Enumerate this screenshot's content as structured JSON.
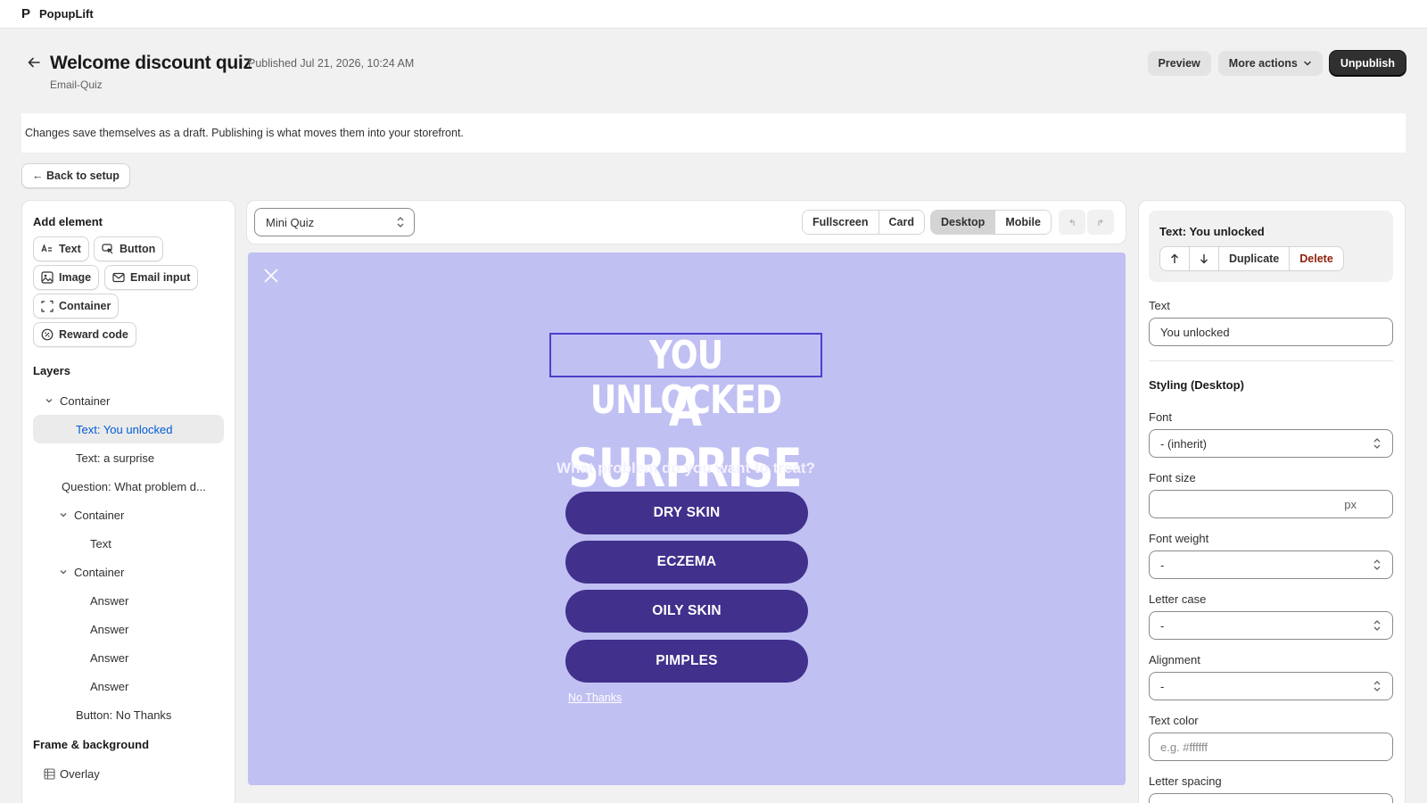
{
  "app": {
    "name": "PopupLift",
    "logo_glyph": "P"
  },
  "header": {
    "title": "Welcome discount quiz",
    "published": "Published Jul 21, 2026, 10:24 AM",
    "subtitle": "Email-Quiz",
    "preview_label": "Preview",
    "more_actions_label": "More actions",
    "unpublish_label": "Unpublish"
  },
  "banner": {
    "text": "Changes save themselves as a draft. Publishing is what moves them into your storefront."
  },
  "back_to_setup": "← Back to setup",
  "add_element": {
    "title": "Add element",
    "buttons": [
      "Text",
      "Button",
      "Image",
      "Email input",
      "Container",
      "Reward code"
    ]
  },
  "layers": {
    "title": "Layers",
    "items": [
      {
        "label": "Container",
        "depth": 0,
        "expandable": true
      },
      {
        "label": "Text: You unlocked",
        "depth": 1,
        "expandable": false,
        "selected": true
      },
      {
        "label": "Text: a surprise",
        "depth": 1,
        "expandable": false
      },
      {
        "label": "Question: What problem d...",
        "depth": 0,
        "expandable": false
      },
      {
        "label": "Container",
        "depth": 1,
        "expandable": true
      },
      {
        "label": "Text",
        "depth": 2,
        "expandable": false
      },
      {
        "label": "Container",
        "depth": 1,
        "expandable": true
      },
      {
        "label": "Answer",
        "depth": 2,
        "expandable": false
      },
      {
        "label": "Answer",
        "depth": 2,
        "expandable": false
      },
      {
        "label": "Answer",
        "depth": 2,
        "expandable": false
      },
      {
        "label": "Answer",
        "depth": 2,
        "expandable": false
      },
      {
        "label": "Button: No Thanks",
        "depth": 1,
        "expandable": false
      }
    ]
  },
  "frame_background": {
    "title": "Frame & background",
    "overlay_label": "Overlay"
  },
  "canvas": {
    "step_select": "Mini Quiz",
    "layout_options": [
      "Fullscreen",
      "Card"
    ],
    "device_options": [
      "Desktop",
      "Mobile"
    ],
    "active_device": "Desktop"
  },
  "popup": {
    "title_line1": "YOU UNLOCKED",
    "title_line2": "A SURPRISE",
    "question": "What problem do you want to treat?",
    "answers": [
      "DRY SKIN",
      "ECZEMA",
      "OILY SKIN",
      "PIMPLES"
    ],
    "no_thanks": "No Thanks",
    "bg_color": "#c1c0f3",
    "answer_color": "#41308c"
  },
  "inspector": {
    "selected_title": "Text: You unlocked",
    "actions": [
      "Duplicate",
      "Delete"
    ],
    "text_label": "Text",
    "text_value": "You unlocked",
    "styling_title": "Styling (Desktop)",
    "font_label": "Font",
    "font_value": "- (inherit)",
    "font_size_label": "Font size",
    "font_size_unit": "px",
    "font_weight_label": "Font weight",
    "font_weight_value": "-",
    "letter_case_label": "Letter case",
    "letter_case_value": "-",
    "alignment_label": "Alignment",
    "alignment_value": "-",
    "text_color_label": "Text color",
    "text_color_placeholder": "e.g. #ffffff",
    "letter_spacing_label": "Letter spacing"
  }
}
